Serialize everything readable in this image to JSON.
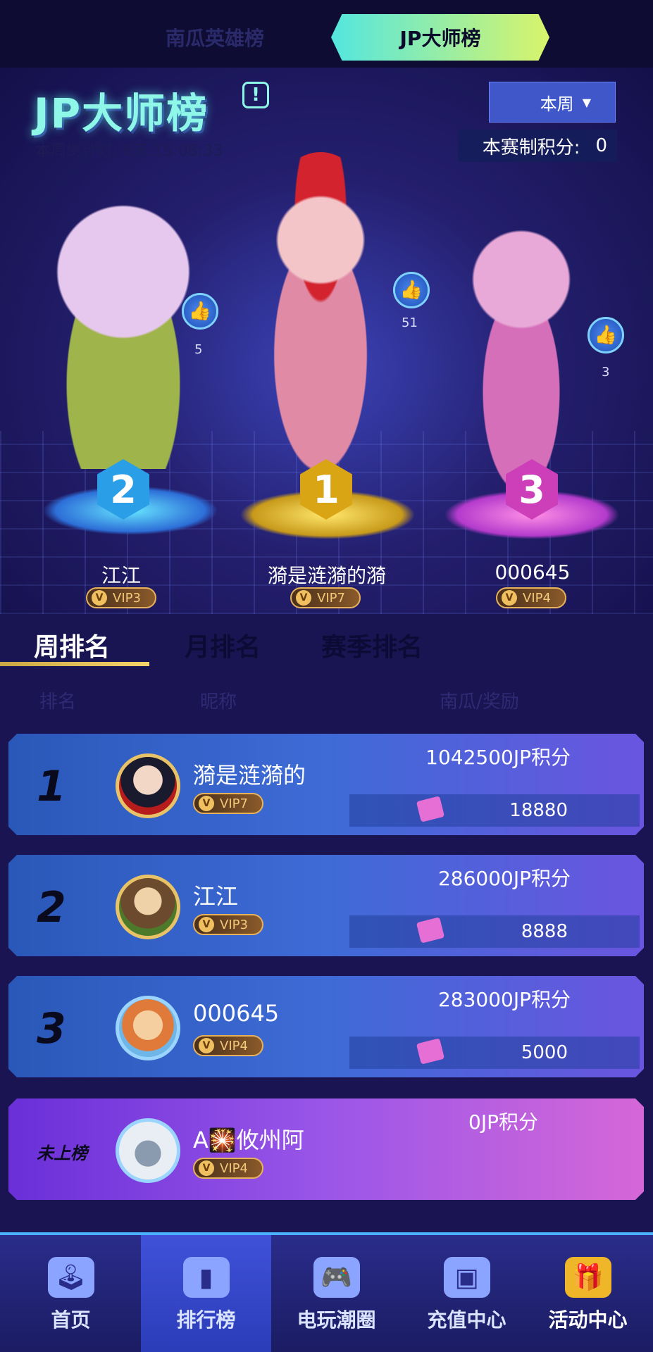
{
  "top_tabs": {
    "tab1": "南瓜英雄榜",
    "tab2": "JP大师榜"
  },
  "hero": {
    "title": "JP大师榜",
    "info_icon": "!",
    "countdown_label": "本周倒计时:",
    "countdown_value": "6天 15:08:33",
    "period_select": "本周",
    "score_label": "本赛制积分:",
    "score_value": "0"
  },
  "podium": [
    {
      "place": "2",
      "name": "江江",
      "vip": "VIP3",
      "likes": "5"
    },
    {
      "place": "1",
      "name": "漪是涟漪的漪",
      "vip": "VIP7",
      "likes": "51"
    },
    {
      "place": "3",
      "name": "000645",
      "vip": "VIP4",
      "likes": "3"
    }
  ],
  "rank_tabs": {
    "week": "周排名",
    "month": "月排名",
    "season": "赛季排名"
  },
  "columns": {
    "rank": "排名",
    "nickname": "昵称",
    "reward": "南瓜/奖励"
  },
  "rows": [
    {
      "rank": "1",
      "name": "漪是涟漪的",
      "vip": "VIP7",
      "points": "1042500JP积分",
      "reward": "18880"
    },
    {
      "rank": "2",
      "name": "江江",
      "vip": "VIP3",
      "points": "286000JP积分",
      "reward": "8888"
    },
    {
      "rank": "3",
      "name": "000645",
      "vip": "VIP4",
      "points": "283000JP积分",
      "reward": "5000"
    }
  ],
  "self_row": {
    "rank": "未上榜",
    "name": "A🎇攸州阿",
    "vip": "VIP4",
    "points": "0JP积分"
  },
  "bottom_nav": [
    {
      "label": "首页",
      "icon": "joystick-icon"
    },
    {
      "label": "排行榜",
      "icon": "bar-chart-icon"
    },
    {
      "label": "电玩潮圈",
      "icon": "gamepad-icon"
    },
    {
      "label": "充值中心",
      "icon": "wallet-icon"
    },
    {
      "label": "活动中心",
      "icon": "gift-icon"
    }
  ],
  "colors": {
    "background": "#1a1552",
    "title_cyan": "#8ff7e8",
    "gold": "#e8c266"
  }
}
